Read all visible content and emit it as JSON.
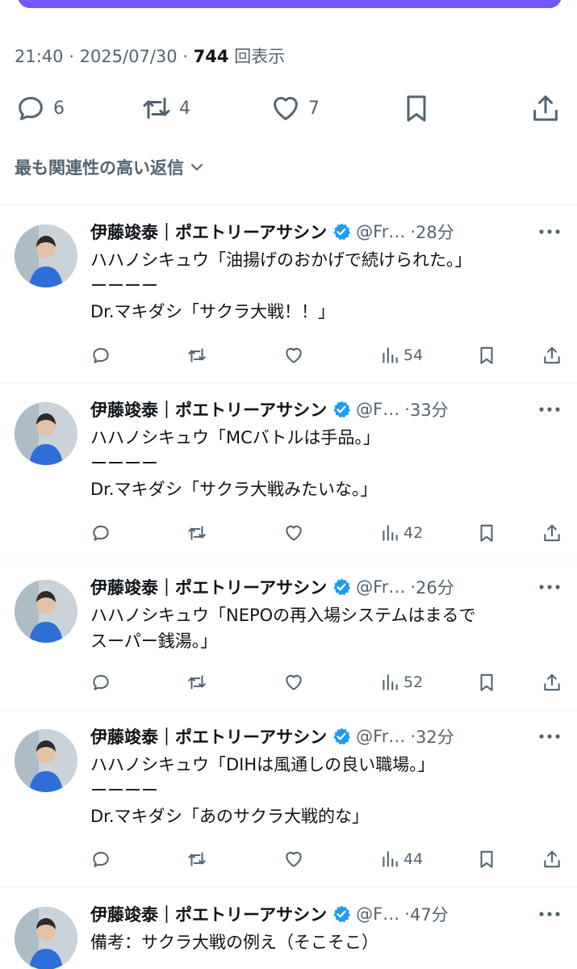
{
  "colors": {
    "accent": "#7856ff",
    "secondary_text": "#536471",
    "verified": "#1d9bf0"
  },
  "tweet": {
    "time": "21:40",
    "date": "2025/07/30",
    "views": "744",
    "views_label": "回表示",
    "reply_count": "6",
    "retweet_count": "4",
    "like_count": "7"
  },
  "sort_label": "最も関連性の高い返信",
  "replies": [
    {
      "name": "伊藤竣泰｜ポエトリーアサシン",
      "handle": "@Fr…",
      "time": "28分",
      "lines": [
        "ハハノシキュウ「油揚げのおかげで続けられた。」",
        "ーーーー",
        "Dr.マキダシ「サクラ大戦！！」"
      ],
      "views": "54"
    },
    {
      "name": "伊藤竣泰｜ポエトリーアサシン",
      "handle": "@F…",
      "time": "33分",
      "lines": [
        "ハハノシキュウ「MCバトルは手品。」",
        "ーーーー",
        "Dr.マキダシ「サクラ大戦みたいな。」"
      ],
      "views": "42"
    },
    {
      "name": "伊藤竣泰｜ポエトリーアサシン",
      "handle": "@Fr…",
      "time": "26分",
      "lines": [
        "ハハノシキュウ「NEPOの再入場システムはまるで",
        "スーパー銭湯。」"
      ],
      "views": "52"
    },
    {
      "name": "伊藤竣泰｜ポエトリーアサシン",
      "handle": "@Fr…",
      "time": "32分",
      "lines": [
        "ハハノシキュウ「DIHは風通しの良い職場。」",
        "ーーーー",
        "Dr.マキダシ「あのサクラ大戦的な」"
      ],
      "views": "44"
    },
    {
      "name": "伊藤竣泰｜ポエトリーアサシン",
      "handle": "@F…",
      "time": "47分",
      "lines": [
        "備考：サクラ大戦の例え（そこそこ）"
      ]
    }
  ]
}
